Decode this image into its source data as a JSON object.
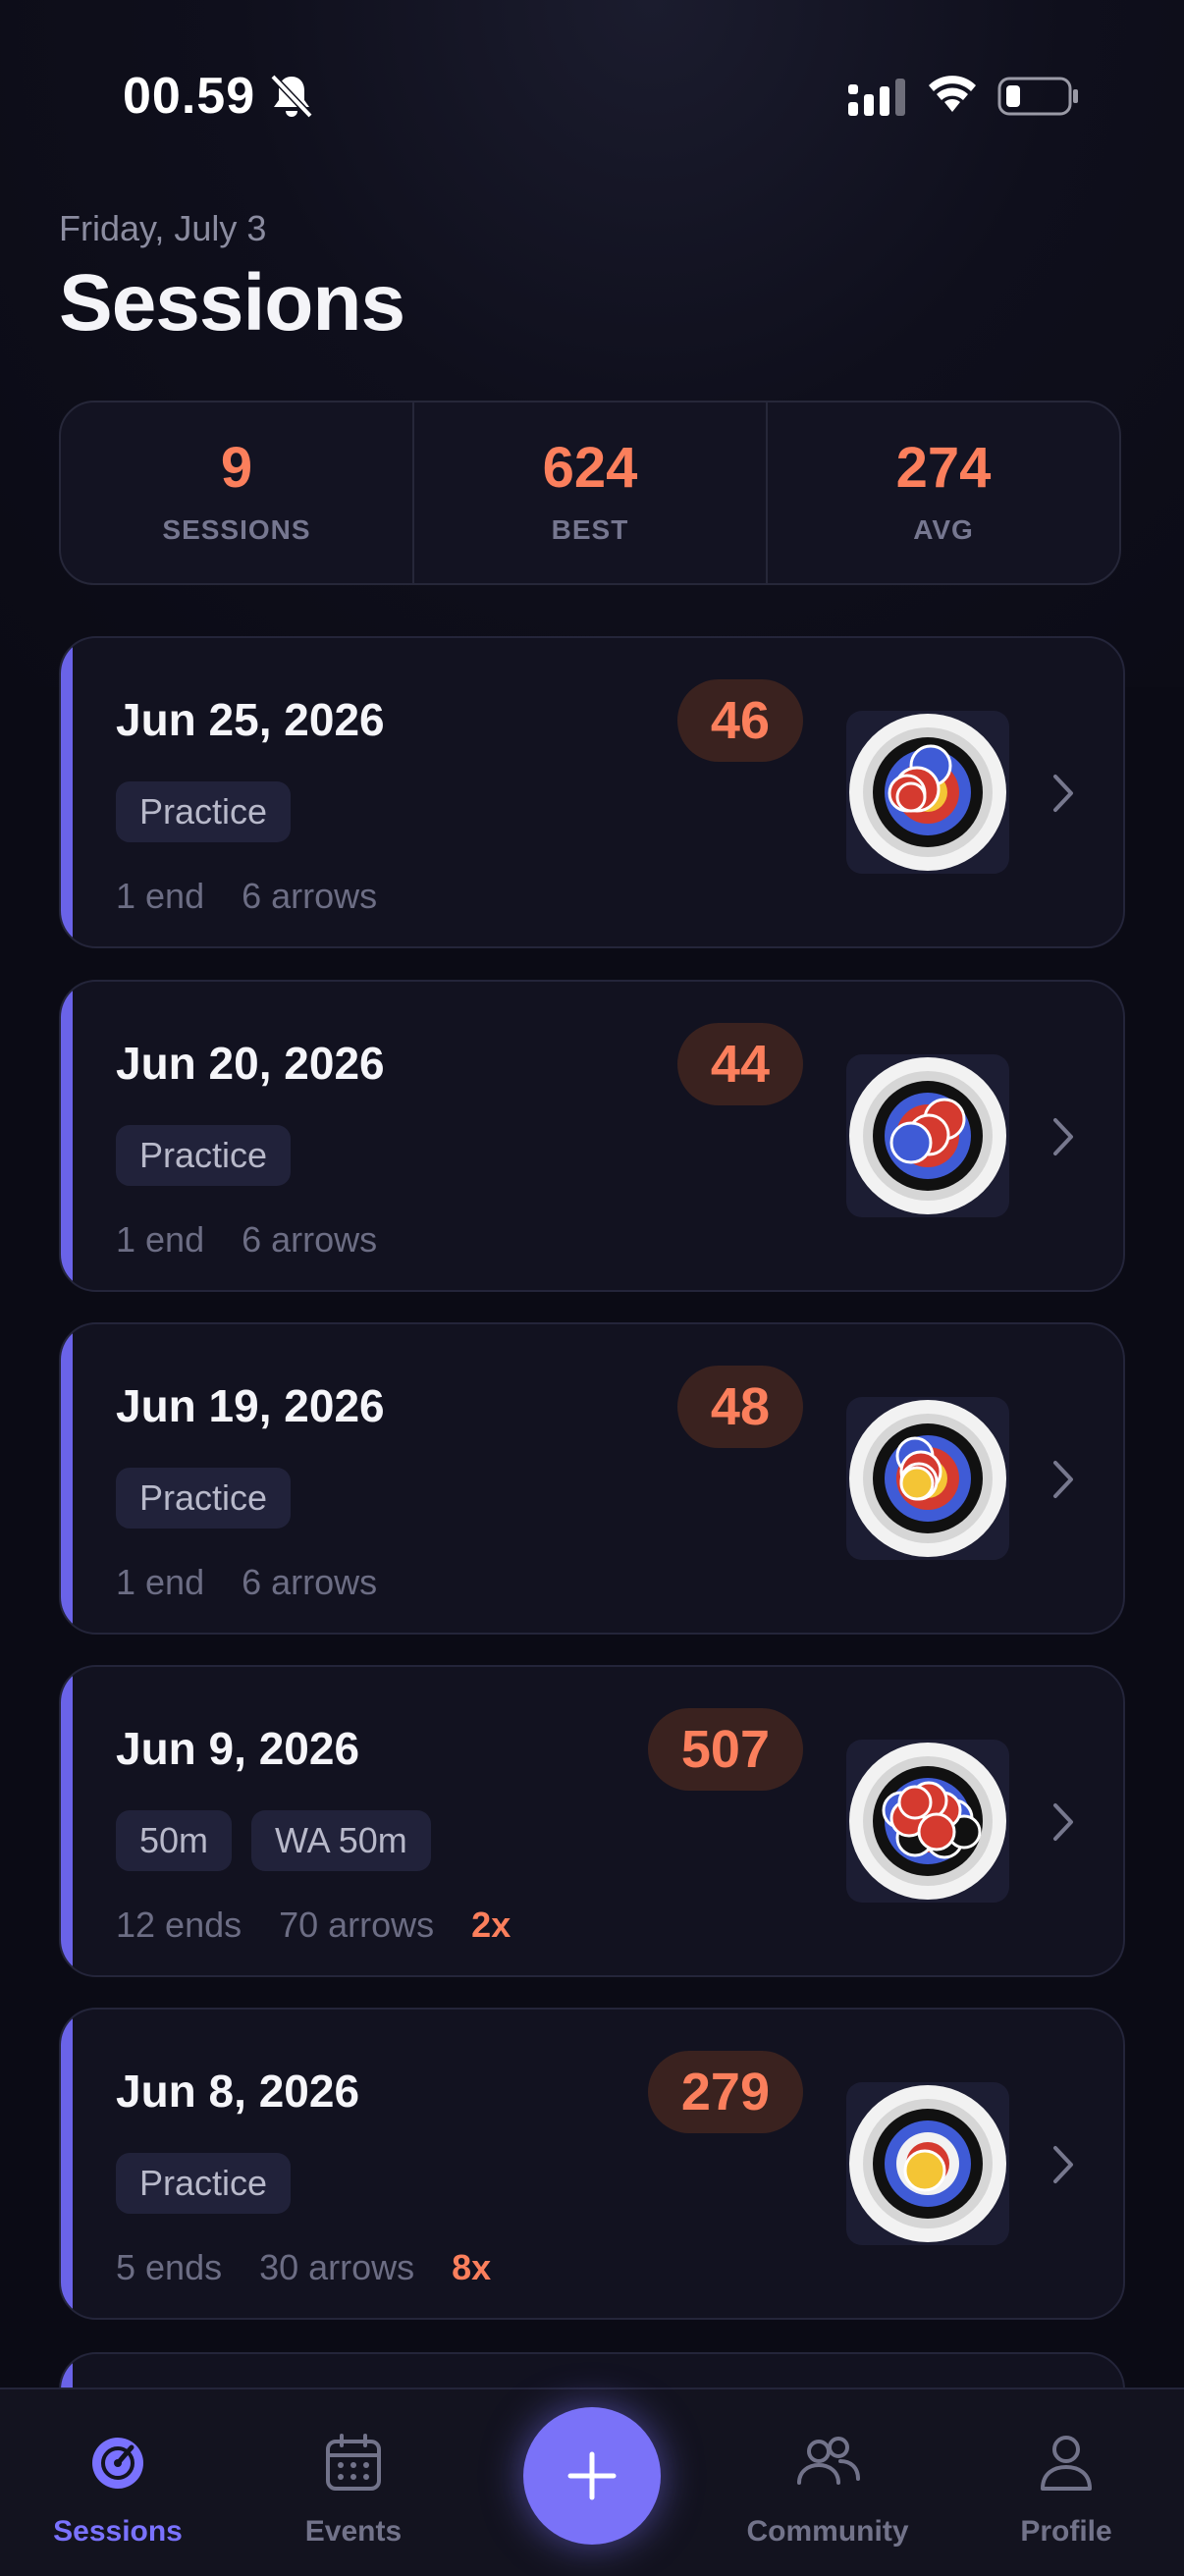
{
  "status_bar": {
    "time": "00.59"
  },
  "header": {
    "date": "Friday, July 3",
    "title": "Sessions"
  },
  "stats": [
    {
      "value": "9",
      "label": "SESSIONS"
    },
    {
      "value": "624",
      "label": "BEST"
    },
    {
      "value": "274",
      "label": "AVG"
    }
  ],
  "sessions": [
    {
      "date": "Jun 25, 2026",
      "score": "46",
      "tags": [
        "Practice"
      ],
      "ends": "1 end",
      "arrows": "6 arrows",
      "multiplier": ""
    },
    {
      "date": "Jun 20, 2026",
      "score": "44",
      "tags": [
        "Practice"
      ],
      "ends": "1 end",
      "arrows": "6 arrows",
      "multiplier": ""
    },
    {
      "date": "Jun 19, 2026",
      "score": "48",
      "tags": [
        "Practice"
      ],
      "ends": "1 end",
      "arrows": "6 arrows",
      "multiplier": ""
    },
    {
      "date": "Jun 9, 2026",
      "score": "507",
      "tags": [
        "50m",
        "WA 50m"
      ],
      "ends": "12 ends",
      "arrows": "70 arrows",
      "multiplier": "2x"
    },
    {
      "date": "Jun 8, 2026",
      "score": "279",
      "tags": [
        "Practice"
      ],
      "ends": "5 ends",
      "arrows": "30 arrows",
      "multiplier": "8x"
    }
  ],
  "tab_bar": {
    "sessions": "Sessions",
    "events": "Events",
    "community": "Community",
    "profile": "Profile"
  },
  "colors": {
    "accent": "#6a63e8",
    "score": "#fb7f5c",
    "fab": "#7a72f8",
    "background": "#0b0b15"
  }
}
